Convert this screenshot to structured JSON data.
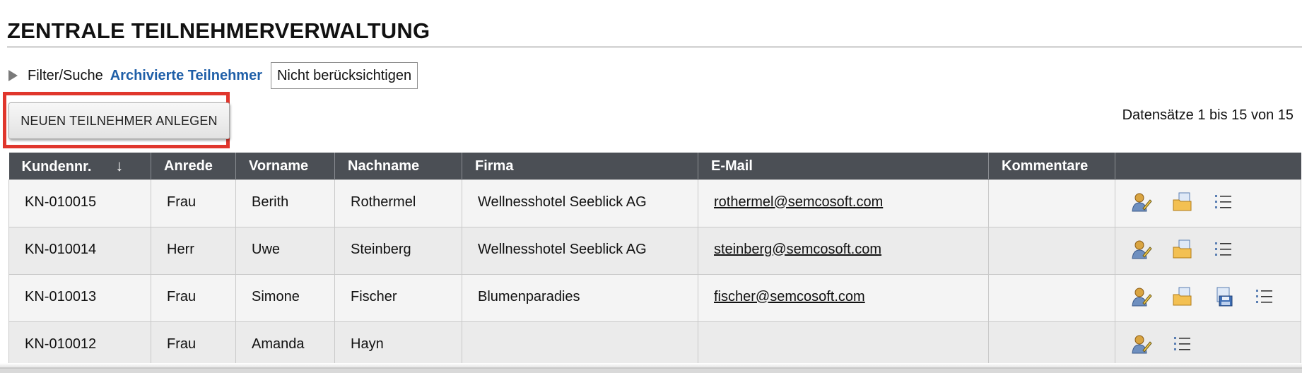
{
  "page": {
    "title": "ZENTRALE TEILNEHMERVERWALTUNG"
  },
  "filter": {
    "toggle_label": "Filter/Suche",
    "archived_label": "Archivierte Teilnehmer",
    "archived_value": "Nicht berücksichtigen"
  },
  "toolbar": {
    "new_button_label": "NEUEN TEILNEHMER ANLEGEN",
    "record_count": "Datensätze 1 bis 15 von 15"
  },
  "table": {
    "sorted_column": "Kundennr.",
    "sort_direction_icon": "↓",
    "columns": [
      "Kundennr.",
      "Anrede",
      "Vorname",
      "Nachname",
      "Firma",
      "E-Mail",
      "Kommentare",
      ""
    ],
    "rows": [
      {
        "kundennr": "KN-010015",
        "anrede": "Frau",
        "vorname": "Berith",
        "nachname": "Rothermel",
        "firma": "Wellnesshotel Seeblick AG",
        "email": "rothermel@semcosoft.com",
        "kommentare": "",
        "actions": [
          "edit-user-icon",
          "folder-document-icon",
          "list-icon"
        ]
      },
      {
        "kundennr": "KN-010014",
        "anrede": "Herr",
        "vorname": "Uwe",
        "nachname": "Steinberg",
        "firma": "Wellnesshotel Seeblick AG",
        "email": "steinberg@semcosoft.com",
        "kommentare": "",
        "actions": [
          "edit-user-icon",
          "folder-document-icon",
          "list-icon"
        ]
      },
      {
        "kundennr": "KN-010013",
        "anrede": "Frau",
        "vorname": "Simone",
        "nachname": "Fischer",
        "firma": "Blumenparadies",
        "email": "fischer@semcosoft.com",
        "kommentare": "",
        "actions": [
          "edit-user-icon",
          "folder-document-icon",
          "save-document-icon",
          "list-icon"
        ]
      },
      {
        "kundennr": "KN-010012",
        "anrede": "Frau",
        "vorname": "Amanda",
        "nachname": "Hayn",
        "firma": "",
        "email": "",
        "kommentare": "",
        "actions": [
          "edit-user-icon",
          "list-icon"
        ]
      }
    ]
  },
  "colors": {
    "header_bg": "#4b4f55",
    "highlight": "#e0362c",
    "link": "#1f5fa8"
  }
}
